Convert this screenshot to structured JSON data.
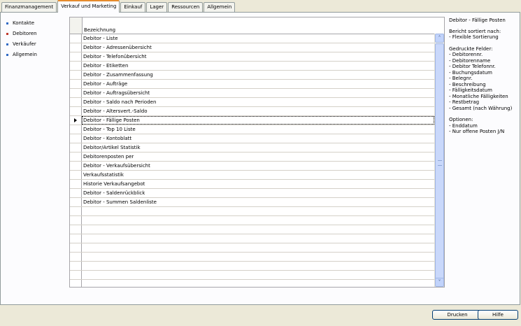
{
  "tabs": [
    {
      "label": "Finanzmanagement",
      "active": false
    },
    {
      "label": "Verkauf und Marketing",
      "active": true
    },
    {
      "label": "Einkauf",
      "active": false
    },
    {
      "label": "Lager",
      "active": false
    },
    {
      "label": "Ressourcen",
      "active": false
    },
    {
      "label": "Allgemein",
      "active": false
    }
  ],
  "sidebar": {
    "items": [
      {
        "label": "Kontakte",
        "color": "#316ac5"
      },
      {
        "label": "Debitoren",
        "color": "#c0392b"
      },
      {
        "label": "Verkäufer",
        "color": "#316ac5"
      },
      {
        "label": "Allgemein",
        "color": "#316ac5"
      }
    ]
  },
  "grid": {
    "column_header": "Bezeichnung",
    "rows": [
      "Debitor - Liste",
      "Debitor - Adressenübersicht",
      "Debitor - Telefonübersicht",
      "Debitor - Etiketten",
      "Debitor - Zusammenfassung",
      "Debitor - Aufträge",
      "Debitor - Auftragsübersicht",
      "Debitor - Saldo nach Perioden",
      "Debitor - Altersvert.-Saldo",
      "Debitor - Fällige Posten",
      "Debitor - Top 10 Liste",
      "Debitor - Kontoblatt",
      "Debitor/Artikel Statistik",
      "Debitorenposten per",
      "Debitor - Verkaufsübersicht",
      "Verkaufsstatistik",
      "Historie Verkaufsangebot",
      "Debitor - Saldenrückblick",
      "Debitor - Summen Saldenliste",
      "",
      "",
      "",
      "",
      "",
      "",
      "",
      "",
      "",
      "",
      "",
      ""
    ],
    "current_index": 9
  },
  "description": {
    "title": "Debitor - Fällige Posten",
    "sort_heading": "Bericht sortiert nach:",
    "sort_lines": [
      "- Flexible Sortierung"
    ],
    "fields_heading": "Gedruckte Felder:",
    "fields": [
      "- Debitorennr.",
      "- Debitorenname",
      "- Debitor Telefonnr.",
      "- Buchungsdatum",
      "- Belegnr.",
      "- Beschreibung",
      "- Fälligkeitsdatum",
      "- Monatliche Fälligkeiten",
      "- Restbetrag",
      "- Gesamt (nach Währung)"
    ],
    "options_heading": "Optionen:",
    "options": [
      "- Enddatum",
      "- Nur offene Posten J/N"
    ]
  },
  "footer": {
    "print_label": "Drucken",
    "help_label": "Hilfe"
  }
}
